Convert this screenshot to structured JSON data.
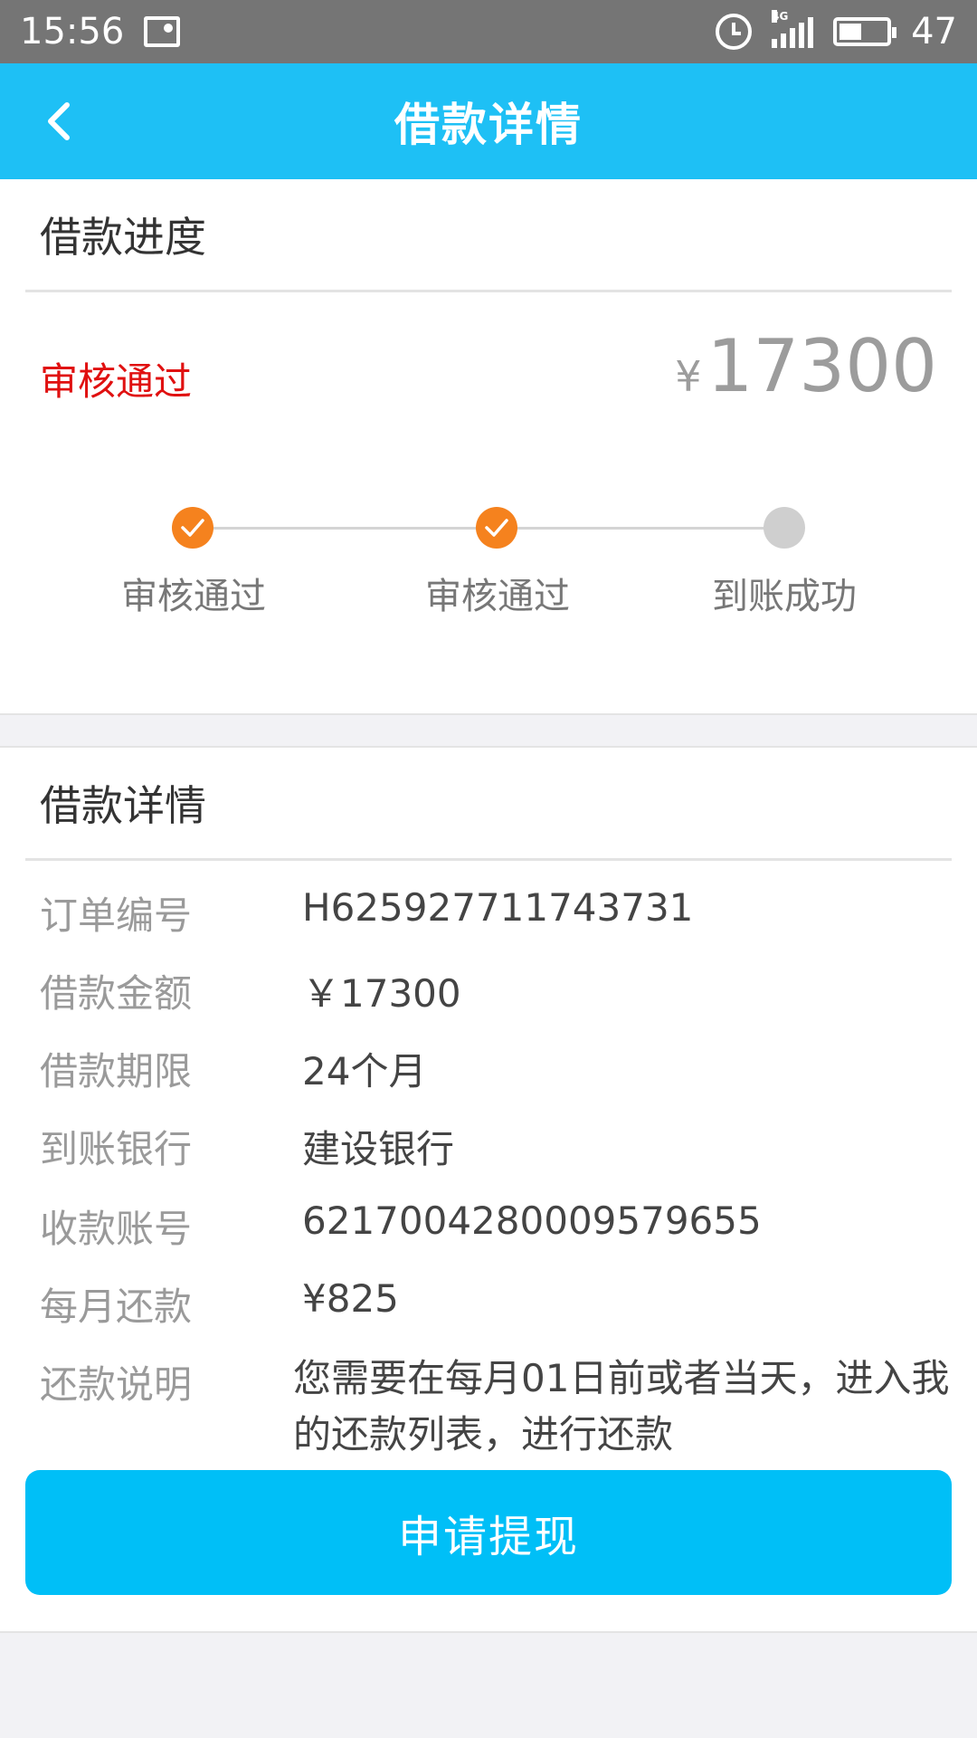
{
  "status_bar": {
    "time": "15:56",
    "network": "4G",
    "battery": "47",
    "icons": [
      "image-icon",
      "alarm-icon",
      "signal-icon",
      "battery-icon"
    ]
  },
  "header": {
    "title": "借款详情",
    "back_icon": "chevron-left-icon"
  },
  "progress": {
    "section_title": "借款进度",
    "status": "审核通过",
    "currency_symbol": "¥",
    "amount": "17300",
    "steps": [
      {
        "label": "审核通过",
        "done": true
      },
      {
        "label": "审核通过",
        "done": true
      },
      {
        "label": "到账成功",
        "done": false
      }
    ]
  },
  "details": {
    "section_title": "借款详情",
    "rows": [
      {
        "label": "订单编号",
        "value": "H625927711743731"
      },
      {
        "label": "借款金额",
        "value": "￥17300"
      },
      {
        "label": "借款期限",
        "value": "24个月"
      },
      {
        "label": "到账银行",
        "value": "建设银行"
      },
      {
        "label": "收款账号",
        "value": "6217004280009579655"
      },
      {
        "label": "每月还款",
        "value": "¥825"
      },
      {
        "label": "还款说明",
        "value": "您需要在每月01日前或者当天，进入我的还款列表，进行还款"
      }
    ]
  },
  "action": {
    "submit_label": "申请提现"
  },
  "colors": {
    "accent": "#1ec0f5",
    "button": "#00bff7",
    "status_red": "#e01010",
    "step_done": "#f5821e",
    "step_todo": "#cfcfcf"
  }
}
